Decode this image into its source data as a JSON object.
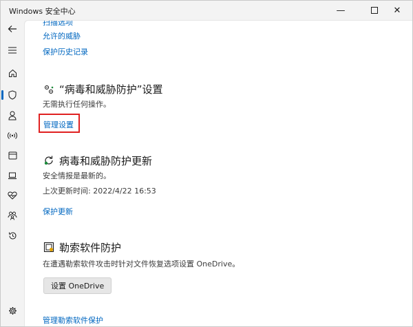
{
  "window": {
    "title": "Windows 安全中心",
    "minimize_glyph": "—",
    "close_glyph": "✕"
  },
  "nav": {
    "items": [
      {
        "name": "back-arrow-icon"
      },
      {
        "name": "hamburger-menu-icon"
      },
      {
        "name": "home-icon"
      },
      {
        "name": "shield-icon",
        "active": true
      },
      {
        "name": "person-icon"
      },
      {
        "name": "wifi-antenna-icon"
      },
      {
        "name": "app-browser-icon"
      },
      {
        "name": "laptop-icon"
      },
      {
        "name": "heart-health-icon"
      },
      {
        "name": "family-icon"
      },
      {
        "name": "history-icon"
      },
      {
        "name": "settings-gear-icon"
      }
    ]
  },
  "top_links": {
    "scan_options": "扫描选项",
    "allowed_threats": "允许的威胁",
    "protection_history": "保护历史记录"
  },
  "virus_settings": {
    "title": "“病毒和威胁防护”设置",
    "status": "无需执行任何操作。",
    "manage_link": "管理设置"
  },
  "virus_updates": {
    "title": "病毒和威胁防护更新",
    "status": "安全情报是最新的。",
    "last_update": "上次更新时间: 2022/4/22 16:53",
    "update_link": "保护更新"
  },
  "ransomware": {
    "title": "勒索软件防护",
    "description": "在遭遇勒索软件攻击时针对文件恢复选项设置 OneDrive。",
    "setup_button": "设置 OneDrive",
    "manage_link": "管理勒索软件保护"
  },
  "colors": {
    "accent": "#0067c0",
    "highlight": "#e02020"
  }
}
